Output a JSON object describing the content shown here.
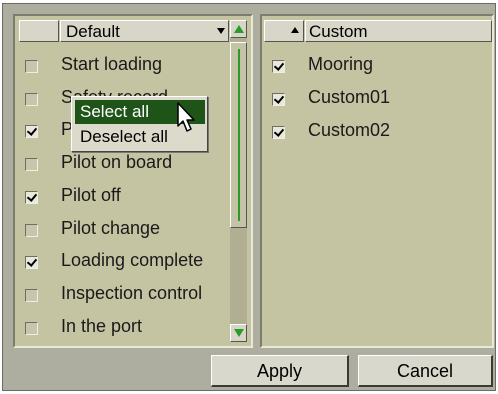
{
  "left_panel": {
    "header": {
      "label": "Default"
    },
    "items": [
      {
        "label": "Start loading",
        "checked": false
      },
      {
        "label": "Safety record",
        "checked": false
      },
      {
        "label": "Pilot in",
        "checked": true
      },
      {
        "label": "Pilot on board",
        "checked": false
      },
      {
        "label": "Pilot off",
        "checked": true
      },
      {
        "label": "Pilot change",
        "checked": false
      },
      {
        "label": "Loading complete",
        "checked": true
      },
      {
        "label": "Inspection control",
        "checked": false
      },
      {
        "label": "In the port",
        "checked": false
      }
    ]
  },
  "right_panel": {
    "header": {
      "label": "Custom"
    },
    "items": [
      {
        "label": "Mooring",
        "checked": true
      },
      {
        "label": "Custom01",
        "checked": true
      },
      {
        "label": "Custom02",
        "checked": true
      }
    ]
  },
  "context_menu": {
    "items": [
      {
        "label": "Select all",
        "selected": true
      },
      {
        "label": "Deselect all",
        "selected": false
      }
    ]
  },
  "footer": {
    "apply_label": "Apply",
    "cancel_label": "Cancel"
  },
  "colors": {
    "panel_bg": "#c4c3a2",
    "window_bg": "#aeaea0",
    "scroll_accent": "#2a9a2a",
    "menu_highlight": "#1f5418"
  }
}
